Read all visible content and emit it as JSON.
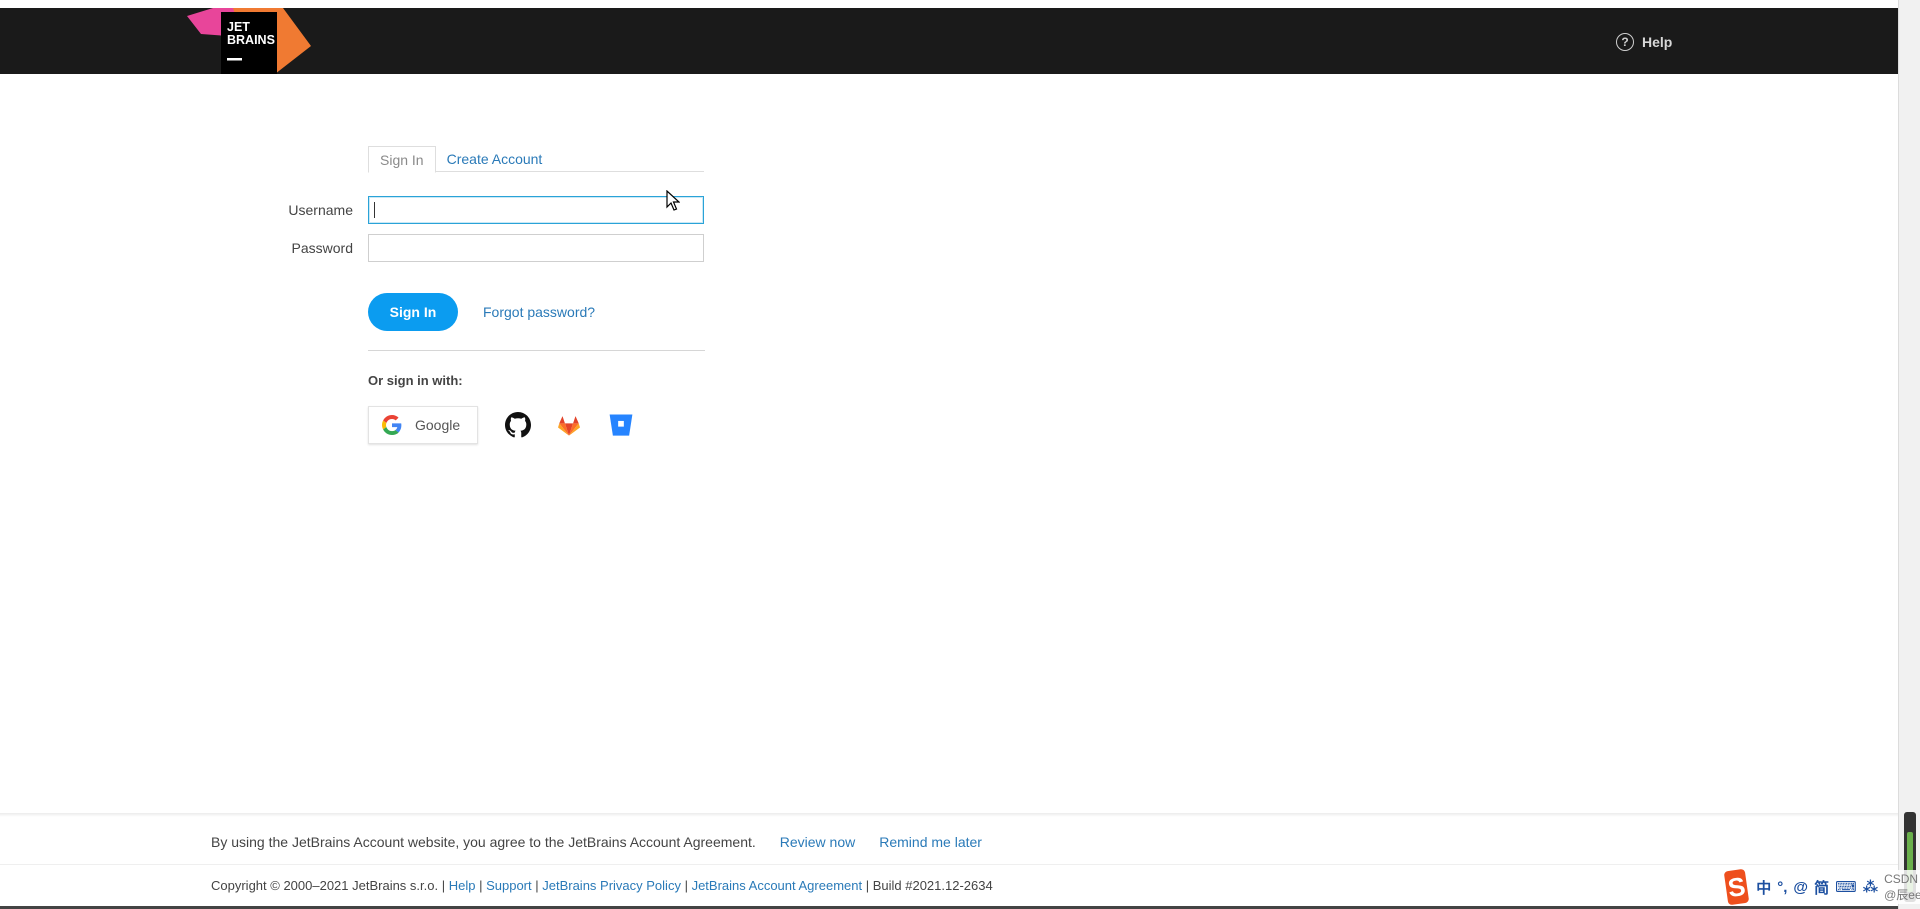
{
  "header": {
    "logo": {
      "line1": "JET",
      "line2": "BRAINS"
    },
    "help_label": "Help"
  },
  "tabs": [
    {
      "label": "Sign In",
      "active": true
    },
    {
      "label": "Create Account",
      "active": false
    }
  ],
  "form": {
    "username_label": "Username",
    "username_value": "",
    "password_label": "Password",
    "password_value": "",
    "signin_button": "Sign In",
    "forgot_password": "Forgot password?"
  },
  "social": {
    "heading": "Or sign in with:",
    "google_label": "Google",
    "providers": [
      "github-icon",
      "gitlab-icon",
      "bitbucket-icon"
    ]
  },
  "footer": {
    "agreement_text": "By using the JetBrains Account website, you agree to the JetBrains Account Agreement.",
    "review_now": "Review now",
    "remind_later": "Remind me later",
    "copyright": "Copyright © 2000–2021 JetBrains s.r.o. |",
    "links": {
      "help": "Help",
      "support": "Support",
      "privacy": "JetBrains Privacy Policy",
      "agreement": "JetBrains Account Agreement"
    },
    "build": "| Build #2021.12-2634"
  },
  "ime": {
    "logo": "S",
    "items": [
      "中",
      "°,",
      "@",
      "简",
      "⌨",
      "⁂"
    ],
    "overlay_text": "CSDN @辰ee"
  },
  "colors": {
    "header_bg": "#1a1a1a",
    "link": "#2a7ab8",
    "primary_button": "#0b9cf0",
    "focus_border": "#2aa3d8"
  }
}
